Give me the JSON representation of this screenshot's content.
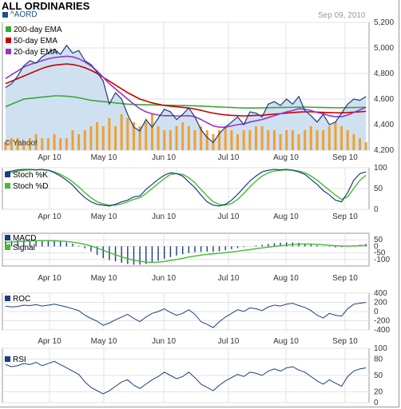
{
  "header": {
    "title": "ALL ORDINARIES",
    "symbol": "^AORD",
    "date": "Sep 09, 2010",
    "watermark": "© Yahoo!"
  },
  "colors": {
    "price": "#1f3a7a",
    "price_fill": "#cfe1f1",
    "ema200": "#3aa635",
    "ema50": "#cc0000",
    "ema20": "#9933cc",
    "volume": "#f0a030",
    "stoch_k": "#1a3e80",
    "stoch_d": "#44bb33",
    "macd": "#1a3e80",
    "signal": "#44bb33",
    "roc": "#1a3e80",
    "rsi": "#1a3e80"
  },
  "chart_data": [
    {
      "type": "line",
      "panel": "price",
      "ylim": [
        4200,
        5200
      ],
      "yticks": [
        "5,200",
        "5,000",
        "4,800",
        "4,600",
        "4,400",
        "4,200"
      ],
      "xticks": [
        "Apr 10",
        "May 10",
        "Jun 10",
        "Jul 10",
        "Aug 10",
        "Sep 10"
      ],
      "series": [
        {
          "name": "^AORD",
          "values": [
            4690,
            4720,
            4780,
            4860,
            4900,
            4880,
            4930,
            4960,
            4990,
            4950,
            5020,
            4960,
            4980,
            4900,
            4870,
            4810,
            4740,
            4560,
            4650,
            4600,
            4480,
            4380,
            4350,
            4440,
            4380,
            4450,
            4520,
            4500,
            4440,
            4480,
            4530,
            4460,
            4360,
            4300,
            4260,
            4330,
            4380,
            4420,
            4460,
            4400,
            4500,
            4490,
            4460,
            4560,
            4580,
            4550,
            4600,
            4560,
            4620,
            4510,
            4470,
            4420,
            4480,
            4400,
            4420,
            4490,
            4560,
            4600,
            4590,
            4620
          ]
        },
        {
          "name": "200-day EMA",
          "values": [
            4540,
            4560,
            4580,
            4600,
            4605,
            4610,
            4615,
            4620,
            4625,
            4625,
            4622,
            4618,
            4610,
            4600,
            4590,
            4585,
            4580,
            4575,
            4570,
            4565,
            4560,
            4558,
            4556,
            4555,
            4554,
            4553,
            4552,
            4551,
            4550,
            4549,
            4548,
            4547,
            4545,
            4543,
            4540,
            4538,
            4536,
            4534,
            4532,
            4530,
            4530,
            4530,
            4531,
            4532,
            4533,
            4534,
            4535,
            4536,
            4537,
            4537,
            4536,
            4535,
            4534,
            4533,
            4532,
            4532,
            4533,
            4534,
            4535,
            4536
          ]
        },
        {
          "name": "50-day EMA",
          "values": [
            4720,
            4740,
            4760,
            4780,
            4800,
            4820,
            4840,
            4855,
            4865,
            4870,
            4875,
            4870,
            4860,
            4845,
            4825,
            4800,
            4770,
            4740,
            4710,
            4680,
            4650,
            4625,
            4600,
            4585,
            4570,
            4560,
            4550,
            4545,
            4540,
            4535,
            4530,
            4522,
            4512,
            4500,
            4490,
            4482,
            4476,
            4472,
            4470,
            4468,
            4470,
            4472,
            4474,
            4478,
            4482,
            4486,
            4490,
            4494,
            4498,
            4500,
            4500,
            4498,
            4496,
            4494,
            4493,
            4492,
            4494,
            4497,
            4500,
            4504
          ]
        },
        {
          "name": "20-day EMA",
          "values": [
            4760,
            4790,
            4820,
            4850,
            4870,
            4885,
            4900,
            4915,
            4925,
            4930,
            4935,
            4930,
            4915,
            4890,
            4860,
            4820,
            4770,
            4720,
            4680,
            4640,
            4600,
            4560,
            4525,
            4500,
            4485,
            4475,
            4470,
            4470,
            4468,
            4468,
            4470,
            4462,
            4440,
            4415,
            4390,
            4380,
            4380,
            4390,
            4400,
            4405,
            4420,
            4430,
            4440,
            4455,
            4470,
            4485,
            4500,
            4510,
            4525,
            4520,
            4510,
            4495,
            4485,
            4470,
            4462,
            4462,
            4475,
            4495,
            4515,
            4535
          ]
        }
      ],
      "volume": [
        2,
        3,
        3,
        2,
        3,
        4,
        3,
        3,
        4,
        3,
        3,
        5,
        4,
        5,
        6,
        7,
        6,
        8,
        6,
        9,
        8,
        7,
        6,
        7,
        9,
        6,
        5,
        5,
        6,
        7,
        6,
        5,
        6,
        5,
        4,
        5,
        6,
        5,
        4,
        5,
        5,
        6,
        6,
        5,
        5,
        4,
        5,
        5,
        4,
        5,
        6,
        5,
        5,
        6,
        7,
        6,
        5,
        4,
        3,
        2
      ]
    },
    {
      "type": "line",
      "panel": "stochastic",
      "ylim": [
        0,
        100
      ],
      "yticks": [
        "100",
        "50",
        "0"
      ],
      "xticks": [
        "Apr 10",
        "May 10",
        "Jun 10",
        "Jul 10",
        "Aug 10",
        "Sep 10"
      ],
      "series": [
        {
          "name": "Stoch %K",
          "values": [
            90,
            92,
            95,
            96,
            96,
            95,
            96,
            94,
            88,
            80,
            70,
            58,
            42,
            28,
            18,
            12,
            10,
            8,
            12,
            18,
            22,
            30,
            32,
            48,
            60,
            72,
            82,
            88,
            86,
            80,
            66,
            52,
            34,
            18,
            10,
            8,
            12,
            22,
            36,
            52,
            68,
            80,
            90,
            94,
            96,
            95,
            96,
            94,
            90,
            84,
            72,
            60,
            45,
            35,
            22,
            18,
            40,
            70,
            86,
            90
          ]
        },
        {
          "name": "Stoch %D",
          "values": [
            86,
            89,
            92,
            94,
            95,
            95,
            95,
            94,
            90,
            84,
            76,
            66,
            54,
            40,
            28,
            18,
            13,
            10,
            10,
            13,
            18,
            24,
            28,
            38,
            50,
            62,
            74,
            84,
            86,
            84,
            76,
            64,
            48,
            32,
            18,
            12,
            10,
            14,
            24,
            38,
            54,
            68,
            80,
            88,
            92,
            94,
            95,
            94,
            92,
            88,
            80,
            70,
            58,
            46,
            34,
            24,
            30,
            50,
            70,
            82
          ]
        }
      ]
    },
    {
      "type": "bar",
      "panel": "macd",
      "ylim": [
        -150,
        100
      ],
      "yticks": [
        "50",
        "0",
        "-50",
        "-100"
      ],
      "xticks": [
        "Apr 10",
        "May 10",
        "Jun 10",
        "Jul 10",
        "Aug 10",
        "Sep 10"
      ],
      "series": [
        {
          "name": "MACD",
          "values": [
            40,
            42,
            45,
            46,
            46,
            45,
            44,
            42,
            40,
            36,
            30,
            20,
            5,
            -15,
            -40,
            -65,
            -90,
            -105,
            -115,
            -125,
            -135,
            -140,
            -140,
            -135,
            -125,
            -110,
            -95,
            -82,
            -70,
            -60,
            -50,
            -45,
            -42,
            -40,
            -42,
            -38,
            -30,
            -22,
            -14,
            -6,
            0,
            6,
            12,
            18,
            24,
            28,
            30,
            30,
            28,
            22,
            14,
            8,
            2,
            -4,
            -8,
            -6,
            -2,
            6,
            12,
            18
          ]
        },
        {
          "name": "Signal",
          "values": [
            30,
            33,
            36,
            39,
            41,
            43,
            43,
            43,
            42,
            40,
            37,
            32,
            25,
            15,
            3,
            -12,
            -30,
            -48,
            -64,
            -80,
            -94,
            -106,
            -114,
            -120,
            -122,
            -120,
            -115,
            -108,
            -100,
            -91,
            -82,
            -74,
            -67,
            -61,
            -57,
            -53,
            -48,
            -43,
            -37,
            -31,
            -25,
            -18,
            -12,
            -6,
            0,
            5,
            10,
            14,
            17,
            18,
            17,
            15,
            12,
            8,
            5,
            3,
            2,
            3,
            5,
            8
          ]
        }
      ]
    },
    {
      "type": "line",
      "panel": "roc",
      "ylim": [
        -400,
        400
      ],
      "yticks": [
        "400",
        "200",
        "0",
        "-200",
        "-400"
      ],
      "xticks": [
        "Apr 10",
        "May 10",
        "Jun 10",
        "Jul 10",
        "Aug 10",
        "Sep 10"
      ],
      "series": [
        {
          "name": "ROC",
          "values": [
            120,
            100,
            110,
            140,
            130,
            150,
            120,
            140,
            160,
            130,
            100,
            60,
            20,
            -80,
            -150,
            -210,
            -300,
            -250,
            -180,
            -120,
            -60,
            -150,
            -220,
            -120,
            -40,
            0,
            60,
            -20,
            -80,
            -40,
            40,
            -60,
            -220,
            -280,
            -350,
            -220,
            -120,
            -40,
            40,
            0,
            80,
            60,
            20,
            100,
            140,
            120,
            160,
            180,
            130,
            90,
            20,
            -80,
            -140,
            -40,
            -80,
            -100,
            60,
            160,
            180,
            200
          ]
        }
      ]
    },
    {
      "type": "line",
      "panel": "rsi",
      "ylim": [
        0,
        100
      ],
      "yticks": [
        "100",
        "80",
        "50",
        "20",
        "0"
      ],
      "xticks": [
        "Apr 10",
        "May 10",
        "Jun 10",
        "Jul 10",
        "Aug 10",
        "Sep 10"
      ],
      "series": [
        {
          "name": "RSI",
          "values": [
            70,
            66,
            68,
            72,
            70,
            74,
            68,
            72,
            76,
            70,
            64,
            58,
            52,
            38,
            28,
            22,
            16,
            22,
            30,
            38,
            42,
            32,
            26,
            34,
            42,
            48,
            56,
            50,
            44,
            48,
            56,
            46,
            34,
            28,
            22,
            32,
            40,
            46,
            52,
            48,
            56,
            54,
            50,
            58,
            62,
            58,
            64,
            66,
            60,
            56,
            48,
            40,
            34,
            42,
            36,
            30,
            48,
            58,
            62,
            64
          ]
        }
      ]
    }
  ]
}
